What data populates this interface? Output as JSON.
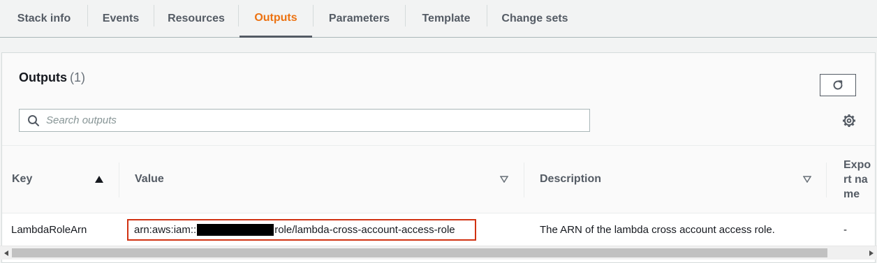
{
  "tabs": [
    {
      "label": "Stack info"
    },
    {
      "label": "Events"
    },
    {
      "label": "Resources"
    },
    {
      "label": "Outputs"
    },
    {
      "label": "Parameters"
    },
    {
      "label": "Template"
    },
    {
      "label": "Change sets"
    }
  ],
  "active_tab": "Outputs",
  "panel": {
    "title": "Outputs",
    "count": "(1)"
  },
  "search": {
    "placeholder": "Search outputs",
    "value": ""
  },
  "table": {
    "columns": [
      "Key",
      "Value",
      "Description",
      "Export name"
    ],
    "rows": [
      {
        "key": "LambdaRoleArn",
        "value_prefix": "arn:aws:iam::",
        "value_suffix": "role/lambda-cross-account-access-role",
        "description": "The ARN of the lambda cross account access role.",
        "export_name": "-"
      }
    ]
  },
  "colors": {
    "accent": "#ec7211",
    "highlight_border": "#d13212",
    "text": "#16191f",
    "muted": "#545b64"
  },
  "icons": [
    "refresh-icon",
    "search-icon",
    "settings-gear-icon",
    "sort-ascending-icon",
    "sort-descending-icon",
    "scroll-left-icon",
    "scroll-right-icon"
  ]
}
